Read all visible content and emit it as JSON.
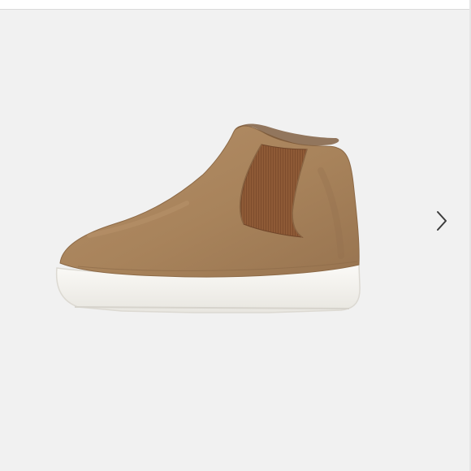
{
  "gallery": {
    "image_subject": "shoe-image",
    "navigation": {
      "next_icon": "chevron-right-icon"
    },
    "colors": {
      "background": "#f1f1f1",
      "suede": "#a9855d",
      "elastic_panel": "#8e5a36",
      "sole": "#f7f6f2",
      "arrow": "#3b3b3b"
    }
  }
}
